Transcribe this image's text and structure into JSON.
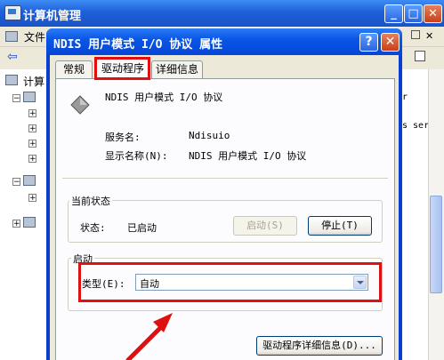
{
  "bg_window": {
    "title": "计算机管理",
    "menu_file": "文件",
    "tree_root": "计算",
    "right_fragments": [
      "r",
      "s ser"
    ],
    "buttons": {
      "minimize": "_",
      "maximize": "□",
      "close": "✕"
    }
  },
  "dialog": {
    "title": "NDIS 用户模式 I/O 协议 属性",
    "help_label": "?",
    "close_label": "✕",
    "tabs": [
      {
        "label": "常规",
        "active": false
      },
      {
        "label": "驱动程序",
        "active": true
      },
      {
        "label": "详细信息",
        "active": false
      }
    ],
    "device_name": "NDIS 用户模式 I/O 协议",
    "service_name_label": "服务名:",
    "service_name_value": "Ndisuio",
    "display_name_label": "显示名称(N):",
    "display_name_value": "NDIS 用户模式 I/O 协议",
    "status_group_title": "当前状态",
    "status_label": "状态:",
    "status_value": "已启动",
    "start_button": "启动(S)",
    "stop_button": "停止(T)",
    "startup_group_title": "启动",
    "type_label": "类型(E):",
    "type_value": "自动",
    "driver_details_button": "驱动程序详细信息(D)..."
  },
  "colors": {
    "highlight": "#e01010",
    "title_blue": "#0a56e6",
    "dialog_face": "#ece9d8"
  },
  "icons": [
    "computer-management-icon",
    "network-protocol-icon",
    "dropdown-arrow-icon",
    "back-arrow-icon",
    "forward-arrow-icon"
  ]
}
